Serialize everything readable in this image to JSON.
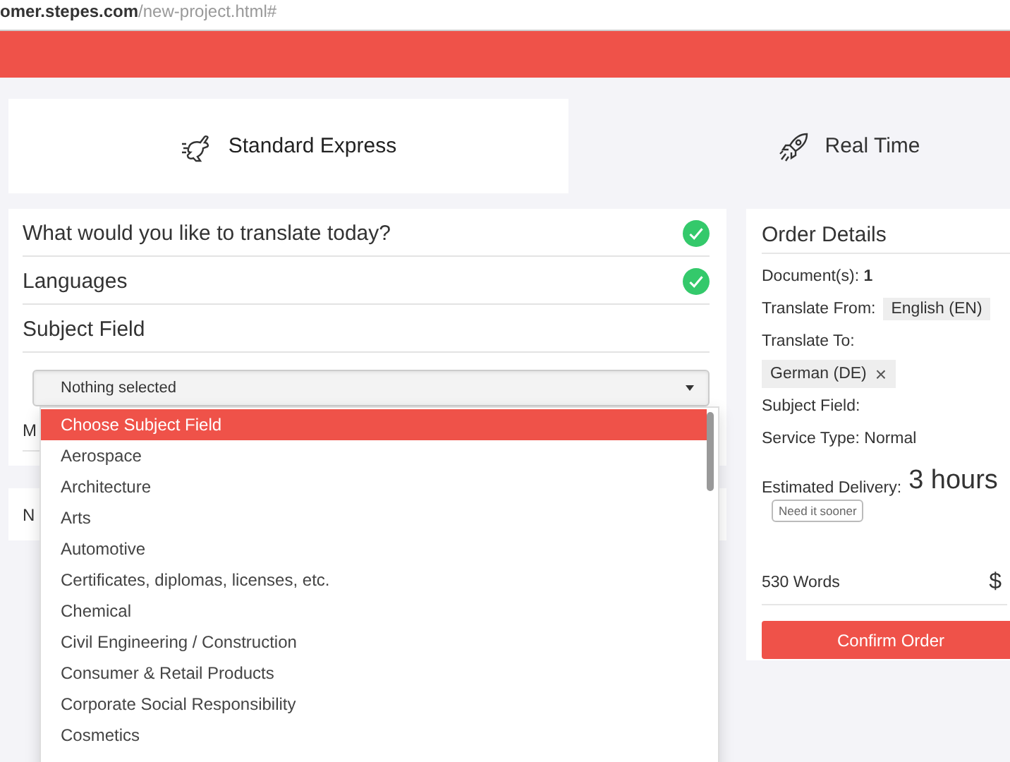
{
  "address_bar": {
    "host": "omer.stepes.com",
    "path": "/new-project.html#"
  },
  "service_tabs": [
    {
      "label": "Standard Express",
      "kind": "rabbit",
      "selected": true
    },
    {
      "label": "Real Time",
      "kind": "rocket",
      "selected": false
    }
  ],
  "steps": [
    {
      "label": "What would you like to translate today?",
      "done": true
    },
    {
      "label": "Languages",
      "done": true
    },
    {
      "label": "Subject Field",
      "done": false
    }
  ],
  "subject_select": {
    "value": "Nothing selected"
  },
  "subject_options": [
    {
      "label": "Choose Subject Field",
      "selected": true
    },
    {
      "label": "Aerospace",
      "selected": false
    },
    {
      "label": "Architecture",
      "selected": false
    },
    {
      "label": "Arts",
      "selected": false
    },
    {
      "label": "Automotive",
      "selected": false
    },
    {
      "label": "Certificates, diplomas, licenses, etc.",
      "selected": false
    },
    {
      "label": "Chemical",
      "selected": false
    },
    {
      "label": "Civil Engineering / Construction",
      "selected": false
    },
    {
      "label": "Consumer & Retail Products",
      "selected": false
    },
    {
      "label": "Corporate Social Responsibility",
      "selected": false
    },
    {
      "label": "Cosmetics",
      "selected": false
    }
  ],
  "hidden_step_text": "M",
  "next_panel_text": "N",
  "order": {
    "title": "Order Details",
    "documents": "Document(s): **1**",
    "from_label": "Translate From:",
    "from_chip": "English (EN)",
    "to_label": "Translate To:",
    "to_chips": [
      "German (DE)"
    ],
    "chip_remove": "×",
    "subject_label": "Subject Field:",
    "service": "Service Type: Normal",
    "delivery_label": "Estimated Delivery:",
    "delivery_value": "3 hours",
    "sooner_button": "Need it sooner",
    "words": "530 Words",
    "price": "$",
    "confirm_button": "Confirm Order"
  }
}
